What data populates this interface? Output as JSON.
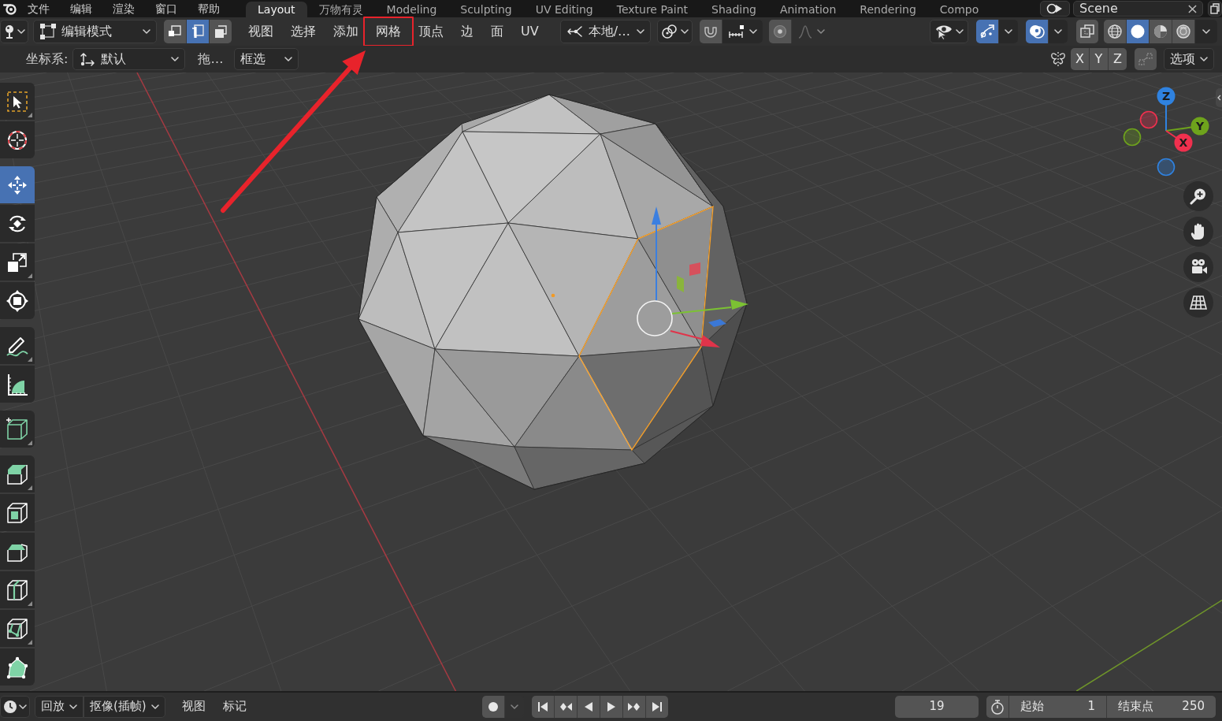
{
  "top_bar": {
    "menus": [
      "文件",
      "编辑",
      "渲染",
      "窗口",
      "帮助"
    ],
    "workspaces": [
      {
        "label": "Layout",
        "selected": true
      },
      {
        "label": "万物有灵",
        "selected": false
      },
      {
        "label": "Modeling",
        "selected": false
      },
      {
        "label": "Sculpting",
        "selected": false
      },
      {
        "label": "UV Editing",
        "selected": false
      },
      {
        "label": "Texture Paint",
        "selected": false
      },
      {
        "label": "Shading",
        "selected": false
      },
      {
        "label": "Animation",
        "selected": false
      },
      {
        "label": "Rendering",
        "selected": false
      },
      {
        "label": "Compo",
        "selected": false
      }
    ],
    "scene": "Scene"
  },
  "header": {
    "mode": "编辑模式",
    "select_modes": [
      {
        "kind": "vertex",
        "selected": false
      },
      {
        "kind": "edge",
        "selected": true
      },
      {
        "kind": "face",
        "selected": false
      }
    ],
    "menus": [
      {
        "label": "视图",
        "highlighted": false
      },
      {
        "label": "选择",
        "highlighted": false
      },
      {
        "label": "添加",
        "highlighted": false
      },
      {
        "label": "网格",
        "highlighted": true
      },
      {
        "label": "顶点",
        "highlighted": false
      },
      {
        "label": "边",
        "highlighted": false
      },
      {
        "label": "面",
        "highlighted": false
      },
      {
        "label": "UV",
        "highlighted": false
      }
    ],
    "orientation": "本地/…",
    "snap_on": false,
    "proportional_on": false,
    "gizmos_on": true,
    "overlays_on": true,
    "xray_on": false,
    "shading": [
      {
        "kind": "wireframe",
        "selected": false
      },
      {
        "kind": "solid",
        "selected": true
      },
      {
        "kind": "material",
        "selected": false
      },
      {
        "kind": "rendered",
        "selected": false
      }
    ]
  },
  "tool_settings": {
    "orientation_label": "坐标系:",
    "orientation_value": "默认",
    "drag_label": "拖…",
    "drag_value": "框选",
    "mirror": [
      {
        "label": "X",
        "on": false
      },
      {
        "label": "Y",
        "on": false
      },
      {
        "label": "Z",
        "on": false
      }
    ],
    "options": "选项"
  },
  "toolbar": [
    [
      {
        "kind": "select_box",
        "selected": false,
        "submenu": true
      },
      {
        "kind": "cursor",
        "selected": false,
        "submenu": false
      }
    ],
    [
      {
        "kind": "move",
        "selected": true,
        "submenu": false
      },
      {
        "kind": "rotate",
        "selected": false,
        "submenu": false
      },
      {
        "kind": "scale",
        "selected": false,
        "submenu": true
      },
      {
        "kind": "transform",
        "selected": false,
        "submenu": false
      }
    ],
    [
      {
        "kind": "annotate",
        "selected": false,
        "submenu": true
      },
      {
        "kind": "measure",
        "selected": false,
        "submenu": false
      }
    ],
    [
      {
        "kind": "add_cube",
        "selected": false,
        "submenu": true
      }
    ],
    [
      {
        "kind": "extrude",
        "selected": false,
        "submenu": true
      },
      {
        "kind": "inset",
        "selected": false,
        "submenu": false
      },
      {
        "kind": "bevel",
        "selected": false,
        "submenu": false
      },
      {
        "kind": "loop_cut",
        "selected": false,
        "submenu": true
      },
      {
        "kind": "knife",
        "selected": false,
        "submenu": true
      },
      {
        "kind": "poly_build",
        "selected": false,
        "submenu": false
      }
    ]
  ],
  "navigation_gizmo": {
    "axes": [
      {
        "label": "Z",
        "color": "#2f82e0"
      },
      {
        "label": "Y",
        "color": "#6ea31c"
      },
      {
        "label": "X",
        "color": "#f0304e"
      }
    ]
  },
  "timeline": {
    "menus": [
      {
        "label": "回放",
        "dropdown": true
      },
      {
        "label": "抠像(插帧)",
        "dropdown": true
      },
      {
        "label": "视图",
        "dropdown": false
      },
      {
        "label": "标记",
        "dropdown": false
      }
    ],
    "current_frame": "19",
    "start_label": "起始",
    "start": "1",
    "end_label": "结束点",
    "end": "250"
  }
}
